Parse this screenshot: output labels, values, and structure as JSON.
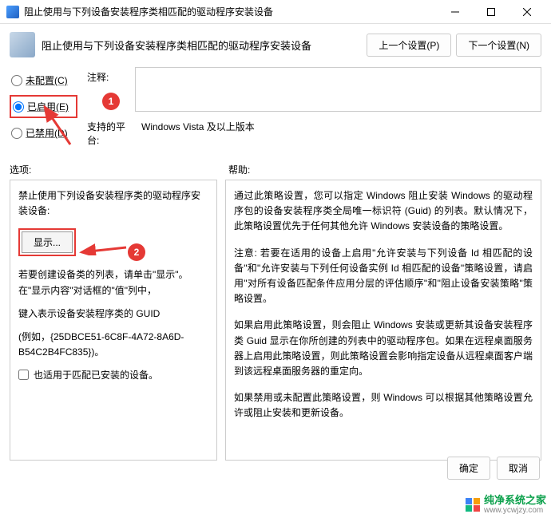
{
  "titlebar": {
    "title": "阻止使用与下列设备安装程序类相匹配的驱动程序安装设备"
  },
  "header": {
    "title": "阻止使用与下列设备安装程序类相匹配的驱动程序安装设备",
    "prev_btn": "上一个设置(P)",
    "next_btn": "下一个设置(N)"
  },
  "radios": {
    "not_configured": "未配置(C)",
    "enabled": "已启用(E)",
    "disabled": "已禁用(D)"
  },
  "info": {
    "comment_label": "注释:",
    "platform_label": "支持的平台:",
    "platform_value": "Windows Vista 及以上版本"
  },
  "sections": {
    "options_label": "选项:",
    "help_label": "帮助:"
  },
  "options_panel": {
    "title": "禁止使用下列设备安装程序类的驱动程序安装设备:",
    "show_btn": "显示...",
    "text1": "若要创建设备类的列表，请单击\"显示\"。在\"显示内容\"对话框的\"值\"列中，",
    "text2": "键入表示设备安装程序类的 GUID",
    "text3": "(例如，{25DBCE51-6C8F-4A72-8A6D-B54C2B4FC835})。",
    "checkbox_label": "也适用于匹配已安装的设备。"
  },
  "help_panel": {
    "p1": "通过此策略设置，您可以指定 Windows 阻止安装 Windows 的驱动程序包的设备安装程序类全局唯一标识符 (Guid) 的列表。默认情况下，此策略设置优先于任何其他允许 Windows 安装设备的策略设置。",
    "p2": "注意: 若要在适用的设备上启用\"允许安装与下列设备 Id 相匹配的设备\"和\"允许安装与下列任何设备实例 Id 相匹配的设备\"策略设置，请启用\"对所有设备匹配条件应用分层的评估顺序\"和\"阻止设备安装策略\"策略设置。",
    "p3": "如果启用此策略设置，则会阻止 Windows 安装或更新其设备安装程序类 Guid 显示在你所创建的列表中的驱动程序包。如果在远程桌面服务器上启用此策略设置，则此策略设置会影响指定设备从远程桌面客户端到该远程桌面服务器的重定向。",
    "p4": "如果禁用或未配置此策略设置，则 Windows 可以根据其他策略设置允许或阻止安装和更新设备。"
  },
  "footer": {
    "ok": "确定",
    "cancel": "取消"
  },
  "annotations": {
    "num1": "1",
    "num2": "2"
  },
  "watermark": {
    "cn": "纯净系统之家",
    "url": "www.ycwjzy.com"
  }
}
